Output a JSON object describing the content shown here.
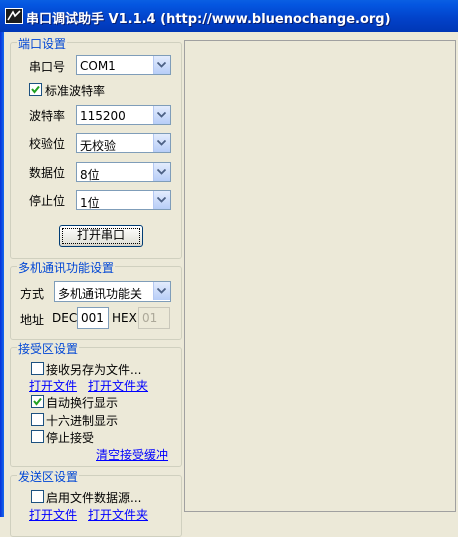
{
  "window": {
    "title": "串口调试助手 V1.1.4 (http://www.bluenochange.org)"
  },
  "port_settings": {
    "group_title": "端口设置",
    "port_label": "串口号",
    "port_value": "COM1",
    "std_baud_label": "标准波特率",
    "std_baud_checked": true,
    "baud_label": "波特率",
    "baud_value": "115200",
    "parity_label": "校验位",
    "parity_value": "无校验",
    "databits_label": "数据位",
    "databits_value": "8位",
    "stopbits_label": "停止位",
    "stopbits_value": "1位",
    "open_button": "打开串口"
  },
  "multi_machine": {
    "group_title": "多机通讯功能设置",
    "mode_label": "方式",
    "mode_value": "多机通讯功能关",
    "address_label": "地址",
    "dec_label": "DEC",
    "dec_value": "001",
    "hex_label": "HEX",
    "hex_value": "01"
  },
  "receive": {
    "group_title": "接受区设置",
    "save_as_file": "接收另存为文件...",
    "save_as_file_checked": false,
    "open_file": "打开文件",
    "open_folder": "打开文件夹",
    "auto_wrap": "自动换行显示",
    "auto_wrap_checked": true,
    "hex_display": "十六进制显示",
    "hex_display_checked": false,
    "stop_receive": "停止接受",
    "stop_receive_checked": false,
    "clear_buffer": "清空接受缓冲"
  },
  "send": {
    "group_title": "发送区设置",
    "use_file_source": "启用文件数据源...",
    "use_file_source_checked": false,
    "open_file": "打开文件",
    "open_folder": "打开文件夹"
  },
  "colors": {
    "titlebar": "#0241c8",
    "group_title": "#0046d5",
    "link": "#0000ff",
    "background": "#ece9d8"
  }
}
